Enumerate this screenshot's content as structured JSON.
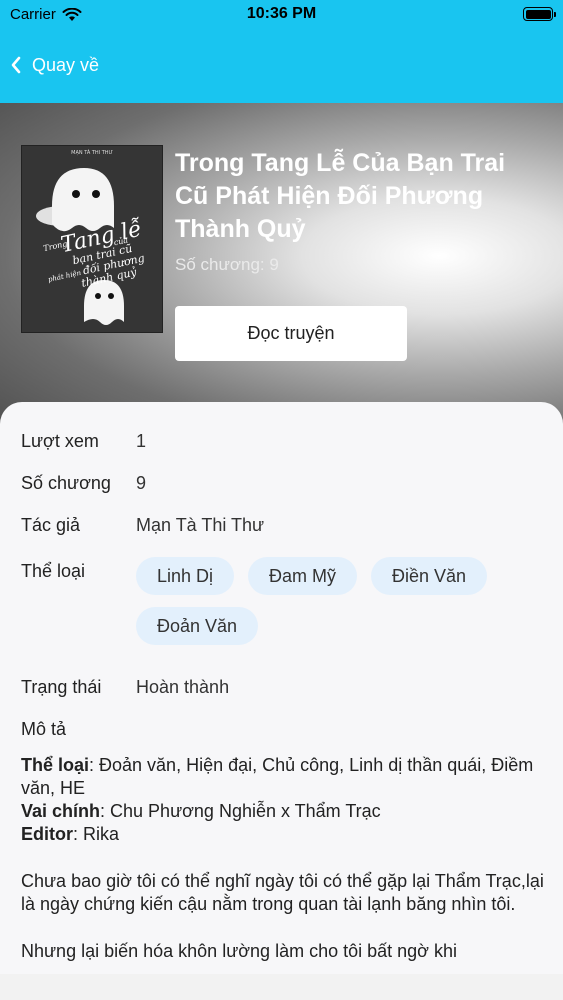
{
  "status_bar": {
    "carrier": "Carrier",
    "time": "10:36 PM"
  },
  "nav": {
    "back_label": "Quay về"
  },
  "book": {
    "title": "Trong Tang Lễ Của Bạn Trai Cũ Phát Hiện Đối Phương Thành Quỷ",
    "chapter_count_label": "Số chương: 9",
    "read_button": "Đọc truyện"
  },
  "details": {
    "views": {
      "label": "Lượt xem",
      "value": "1"
    },
    "chapters": {
      "label": "Số chương",
      "value": "9"
    },
    "author": {
      "label": "Tác giả",
      "value": "Mạn Tà Thi Thư"
    },
    "genre": {
      "label": "Thể loại",
      "tags": [
        "Linh Dị",
        "Đam Mỹ",
        "Điền Văn",
        "Đoản Văn"
      ]
    },
    "status": {
      "label": "Trạng thái",
      "value": "Hoàn thành"
    },
    "description": {
      "label": "Mô tả",
      "genre_key": "Thể loại",
      "genre_text": ": Đoản văn, Hiện đại, Chủ công, Linh dị thần quái, Điềm văn, HE",
      "leads_key": "Vai chính",
      "leads_text": ": Chu Phương Nghiễn x Thẩm Trạc",
      "editor_key": "Editor",
      "editor_text": ": Rika",
      "paragraph1": "Chưa bao giờ tôi có thể nghĩ ngày tôi có thể gặp lại Thẩm Trạc,lại là ngày chứng kiến cậu nằm trong quan tài lạnh băng nhìn tôi.",
      "paragraph2": "Nhưng lại biến hóa khôn lường làm cho tôi bất ngờ khi"
    }
  },
  "cover_art": {
    "top_text": "MẠN TÀ THI THƯ",
    "title_lines": [
      "Trong",
      "Tang lễ",
      "của",
      "bạn trai cũ",
      "phát hiện",
      "đối phương",
      "thành quỷ"
    ]
  }
}
